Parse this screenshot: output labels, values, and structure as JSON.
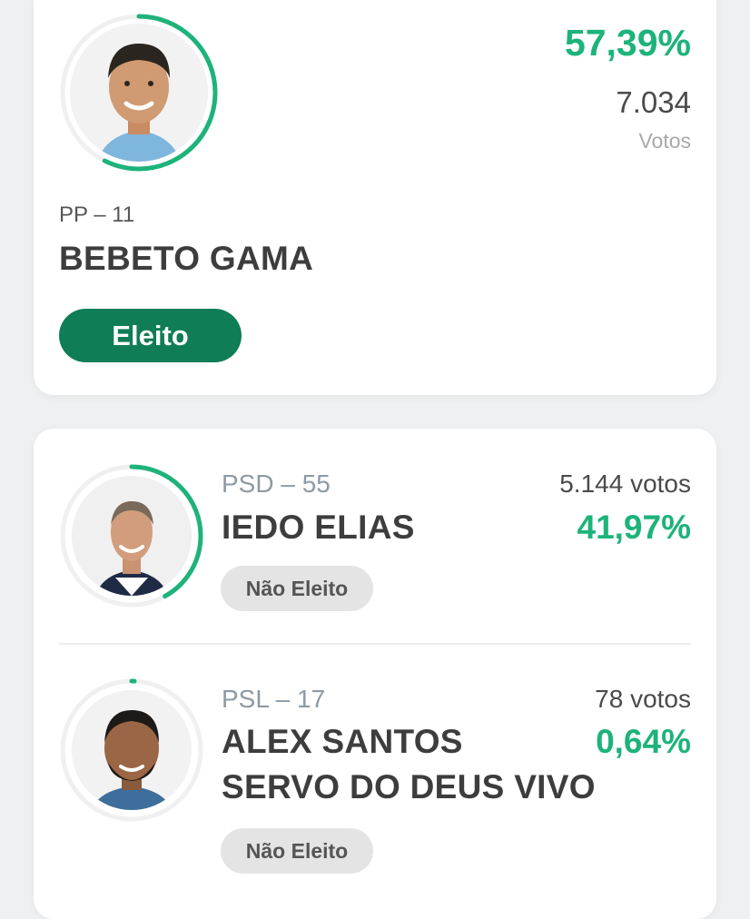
{
  "colors": {
    "accent_green": "#1db37a",
    "elected_badge": "#0f7d55",
    "not_elected_badge": "#e4e4e4",
    "ring_track": "#f0f0f0"
  },
  "winner": {
    "party": "PP – 11",
    "name": "BEBETO GAMA",
    "percent": "57,39%",
    "votes": "7.034",
    "votes_label": "Votos",
    "status": "Eleito",
    "vote_share": 0.5739
  },
  "others": [
    {
      "party": "PSD – 55",
      "name": "IEDO ELIAS",
      "votes": "5.144 votos",
      "percent": "41,97%",
      "status": "Não Eleito",
      "vote_share": 0.4197
    },
    {
      "party": "PSL – 17",
      "name_line1": "ALEX SANTOS",
      "name_line2": "SERVO DO DEUS VIVO",
      "votes": "78 votos",
      "percent": "0,64%",
      "status": "Não Eleito",
      "vote_share": 0.0064
    }
  ]
}
